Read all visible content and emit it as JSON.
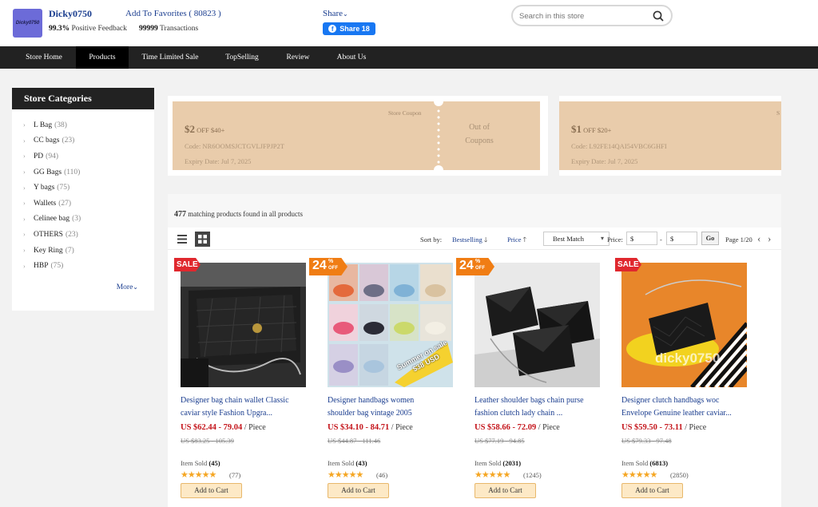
{
  "header": {
    "logo_text": "Dicky0750",
    "store_name": "Dicky0750",
    "favorites": "Add To Favorites ( 80823 )",
    "feedback_pct": "99.3%",
    "feedback_label": "Positive Feedback",
    "transactions_count": "99999",
    "transactions_label": "Transactions",
    "share_label": "Share",
    "fb_share": "Share 18",
    "search_placeholder": "Search in this store"
  },
  "nav": [
    {
      "label": "Store Home",
      "active": false
    },
    {
      "label": "Products",
      "active": true
    },
    {
      "label": "Time Limited Sale",
      "active": false
    },
    {
      "label": "TopSelling",
      "active": false
    },
    {
      "label": "Review",
      "active": false
    },
    {
      "label": "About Us",
      "active": false
    }
  ],
  "sidebar": {
    "title": "Store Categories",
    "categories": [
      {
        "name": "L Bag",
        "count": "(38)"
      },
      {
        "name": "CC bags",
        "count": "(23)"
      },
      {
        "name": "PD",
        "count": "(94)"
      },
      {
        "name": "GG Bags",
        "count": "(110)"
      },
      {
        "name": "Y bags",
        "count": "(75)"
      },
      {
        "name": "Wallets",
        "count": "(27)"
      },
      {
        "name": "Celinee bag",
        "count": "(3)"
      },
      {
        "name": "OTHERS",
        "count": "(23)"
      },
      {
        "name": "Key Ring",
        "count": "(7)"
      },
      {
        "name": "HBP",
        "count": "(75)"
      }
    ],
    "more": "More"
  },
  "coupons": [
    {
      "label": "Store Coupon",
      "amount": "$2",
      "off": "OFF $40+",
      "code": "Code: NR6OOMSJCTGVLJFPJP2T",
      "expiry": "Expiry Date: Jul 7, 2025",
      "status_line1": "Out of",
      "status_line2": "Coupons"
    },
    {
      "label": "S",
      "amount": "$1",
      "off": "OFF $20+",
      "code": "Code: L92FE14QAI54VBC6GHFI",
      "expiry": "Expiry Date: Jul 7, 2025"
    }
  ],
  "results": {
    "count": "477",
    "text": "matching products found in all products"
  },
  "sort": {
    "sort_by": "Sort by:",
    "bestselling": "Bestselling",
    "price": "Price",
    "best_match": "Best Match",
    "price_label": "Price:",
    "min_value": "$",
    "max_value": "$",
    "dash": "-",
    "go": "Go",
    "page": "Page 1/20"
  },
  "products": [
    {
      "badge": "SALE",
      "title_line1": "Designer bag chain wallet Classic",
      "title_line2": "caviar style Fashion Upgra...",
      "price": "US $62.44 - 79.04",
      "unit": "/ Piece",
      "orig": "US $83.25 - 105.39",
      "sold_label": "Item Sold",
      "sold": "(45)",
      "reviews": "(77)",
      "cart": "Add to Cart"
    },
    {
      "badge": "24",
      "title_line1": "Designer handbags women",
      "title_line2": "shoulder bag vintage 2005",
      "price": "US $34.10 - 84.71",
      "unit": "/ Piece",
      "orig": "US $44.87 - 111.46",
      "sold_label": "Item Sold",
      "sold": "(43)",
      "reviews": "(46)",
      "cart": "Add to Cart",
      "img_caption": "Summer on sale $38 USD"
    },
    {
      "badge": "24",
      "title_line1": "Leather shoulder bags chain purse",
      "title_line2": "fashion clutch lady chain ...",
      "price": "US $58.66 - 72.09",
      "unit": "/ Piece",
      "orig": "US $77.19 - 94.85",
      "sold_label": "Item Sold",
      "sold": "(2031)",
      "reviews": "(1245)",
      "cart": "Add to Cart"
    },
    {
      "badge": "SALE",
      "title_line1": "Designer clutch handbags woc",
      "title_line2": "Envelope Genuine leather caviar...",
      "price": "US $59.50 - 73.11",
      "unit": "/ Piece",
      "orig": "US $79.33 - 97.48",
      "sold_label": "Item Sold",
      "sold": "(6813)",
      "reviews": "(2850)",
      "cart": "Add to Cart",
      "watermark": "dicky0750"
    }
  ],
  "badge_pct_sign": "%",
  "badge_off": "OFF",
  "colors": {
    "nav_bg": "#222222",
    "accent_blue": "#1a3d8f",
    "price_red": "#c4161c",
    "coupon": "#e9ccab",
    "sale_badge": "#e0282e",
    "pct_badge": "#f07d14"
  }
}
